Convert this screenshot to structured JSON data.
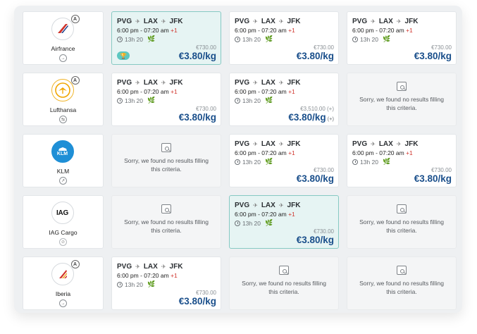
{
  "airlines": [
    {
      "name": "Airfrance",
      "badge": "A",
      "status_icon": "arrow-icon",
      "status_glyph": "→"
    },
    {
      "name": "Lufthansa",
      "badge": "A",
      "status_icon": "refresh-icon",
      "status_glyph": "⇆"
    },
    {
      "name": "KLM",
      "badge": "",
      "status_icon": "trend-icon",
      "status_glyph": "↗",
      "logo_text": "KLM"
    },
    {
      "name": "IAG Cargo",
      "badge": "",
      "status_icon": "blocked-icon",
      "status_glyph": "⊘",
      "logo_text": "IAG"
    },
    {
      "name": "Iberia",
      "badge": "A",
      "status_icon": "arrow-icon",
      "status_glyph": "→"
    }
  ],
  "result": {
    "origin": "PVG",
    "via": "LAX",
    "destination": "JFK",
    "plane_glyph": "✈",
    "times": "6:00 pm - 07:20 am",
    "day_offset": "+1",
    "duration": "13h 20",
    "leaf_glyph": "🌿",
    "original_price": "€730.00",
    "price": "€3.80/kg"
  },
  "alt_result": {
    "original_price": "€3,510.00 (+)",
    "price_suffix": "(+)"
  },
  "empty_message": "Sorry, we found no results filling this criteria.",
  "trophy_glyph": "🏆"
}
